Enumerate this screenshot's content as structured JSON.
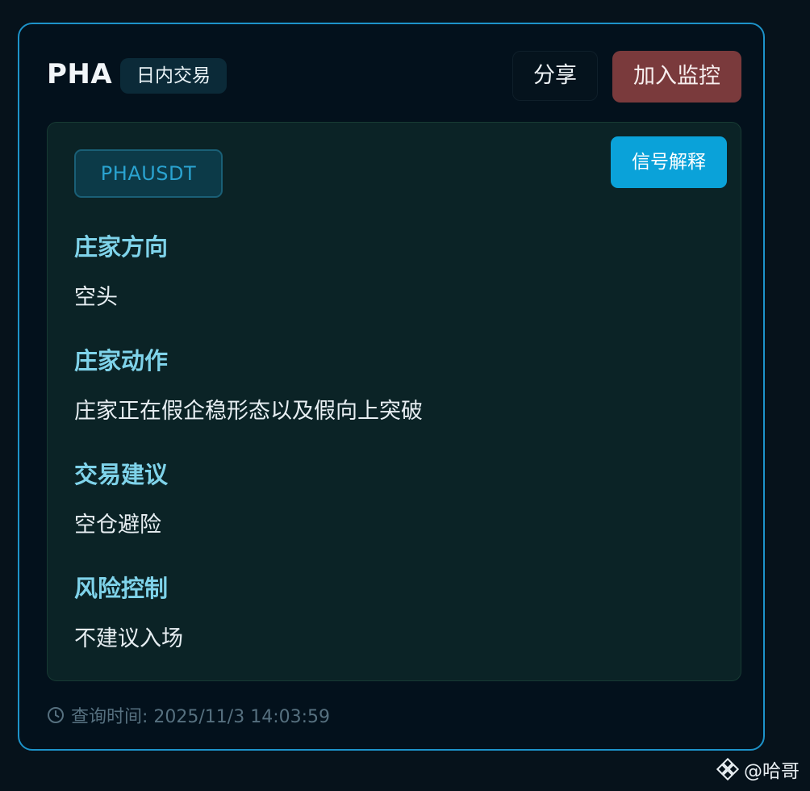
{
  "header": {
    "symbol": "PHA",
    "mode_badge": "日内交易",
    "share_label": "分享",
    "monitor_label": "加入监控"
  },
  "signal": {
    "pair": "PHAUSDT",
    "explain_label": "信号解释",
    "sections": [
      {
        "title": "庄家方向",
        "value": "空头"
      },
      {
        "title": "庄家动作",
        "value": "庄家正在假企稳形态以及假向上突破"
      },
      {
        "title": "交易建议",
        "value": "空仓避险"
      },
      {
        "title": "风险控制",
        "value": "不建议入场"
      }
    ]
  },
  "footer": {
    "query_time": "查询时间: 2025/11/3 14:03:59",
    "icon": "clock-icon"
  },
  "watermark": {
    "text": "@哈哥",
    "icon": "binance-logo-icon"
  },
  "colors": {
    "accent": "#1d93c9",
    "section_title": "#7fd3ea",
    "monitor_button": "#7a3a3c",
    "explain_button": "#0aa2d9"
  }
}
